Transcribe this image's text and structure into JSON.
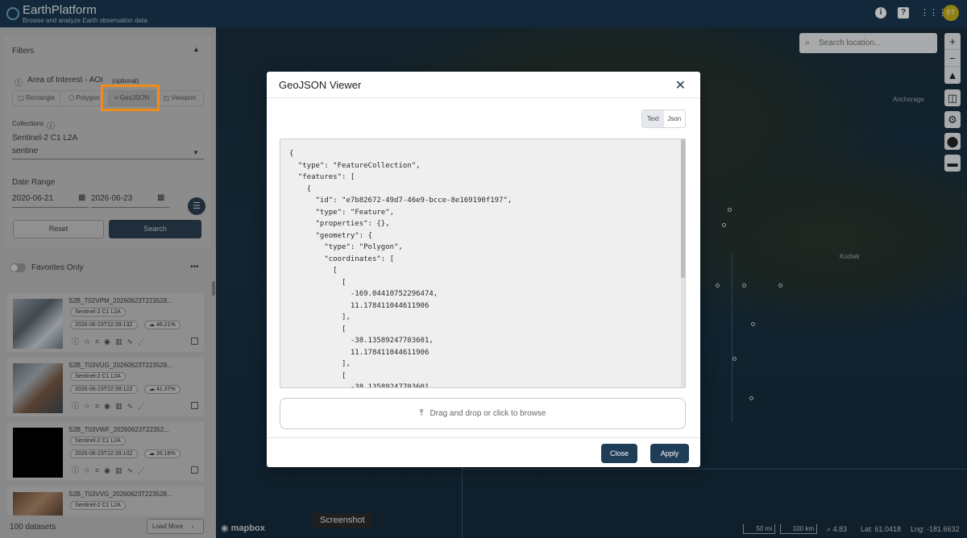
{
  "app": {
    "title": "EarthPlatform",
    "subtitle": "Browse and analyze Earth observation data",
    "header_icons": [
      "info-icon",
      "help-icon",
      "apps-grid-icon"
    ],
    "avatar_initials": "ET",
    "avatar_color": "#c9b21a"
  },
  "sidebar": {
    "filters_title": "Filters",
    "aoi_label": "Area of Interest - AOI",
    "aoi_optional": "(optional)",
    "aoi_modes": [
      "Rectangle",
      "Polygon",
      "GeoJSON",
      "Viewport"
    ],
    "aoi_selected": "GeoJSON",
    "collections_label": "Collections",
    "collection_value": "Sentinel-2 C1 L2A",
    "collection_search": "sentine",
    "date_range_label": "Date Range",
    "date_from": "2020-06-21",
    "date_to": "2026-06-23",
    "reset_label": "Reset",
    "search_label": "Search",
    "favorites_label": "Favorites Only",
    "more_label": "•••",
    "datasets_count": "100 datasets",
    "load_more_label": "Load More"
  },
  "results": [
    {
      "title": "S2B_T02VPM_20260623T223528...",
      "collection": "Sentinel-2 C1 L2A",
      "datetime": "2026-06-23T22:39:13Z",
      "cloud": "46.21%"
    },
    {
      "title": "S2B_T03VUG_20260623T223528...",
      "collection": "Sentinel-2 C1 L2A",
      "datetime": "2026-06-23T22:39:12Z",
      "cloud": "41.37%"
    },
    {
      "title": "S2B_T03VWF_20260623T22352...",
      "collection": "Sentinel-2 C1 L2A",
      "datetime": "2026-06-23T22:39:10Z",
      "cloud": "26.18%"
    },
    {
      "title": "S2B_T03VVG_20260623T223528...",
      "collection": "Sentinel-2 C1 L2A",
      "datetime": "",
      "cloud": ""
    }
  ],
  "map": {
    "search_placeholder": "Search location...",
    "places": [
      "Anchorage",
      "Kodiak"
    ],
    "attribution": "mapbox",
    "tooltip": "Screenshot",
    "scale_mi": "50 mi",
    "scale_km": "100 km",
    "zoom": "4.83",
    "lat_label": "Lat: 61.0418",
    "lng_label": "Lng: -181.6632",
    "controls": [
      "+",
      "−",
      "▲"
    ]
  },
  "modal": {
    "title": "GeoJSON Viewer",
    "mode_text": "Text",
    "mode_json": "Json",
    "mode_selected": "Text",
    "geojson_text": "{\n  \"type\": \"FeatureCollection\",\n  \"features\": [\n    {\n      \"id\": \"e7b82672-49d7-46e9-bcce-8e169190f197\",\n      \"type\": \"Feature\",\n      \"properties\": {},\n      \"geometry\": {\n        \"type\": \"Polygon\",\n        \"coordinates\": [\n          [\n            [\n              -169.04410752296474,\n              11.178411044611906\n            ],\n            [\n              -38.13589247703601,\n              11.178411044611906\n            ],\n            [\n              -38.13589247703601,",
    "dropzone_label": "Drag and drop or click to browse",
    "close_label": "Close",
    "apply_label": "Apply"
  },
  "colors": {
    "header_bg": "#1b3a52",
    "primary": "#1f3d57",
    "highlight": "#f08c1a"
  }
}
